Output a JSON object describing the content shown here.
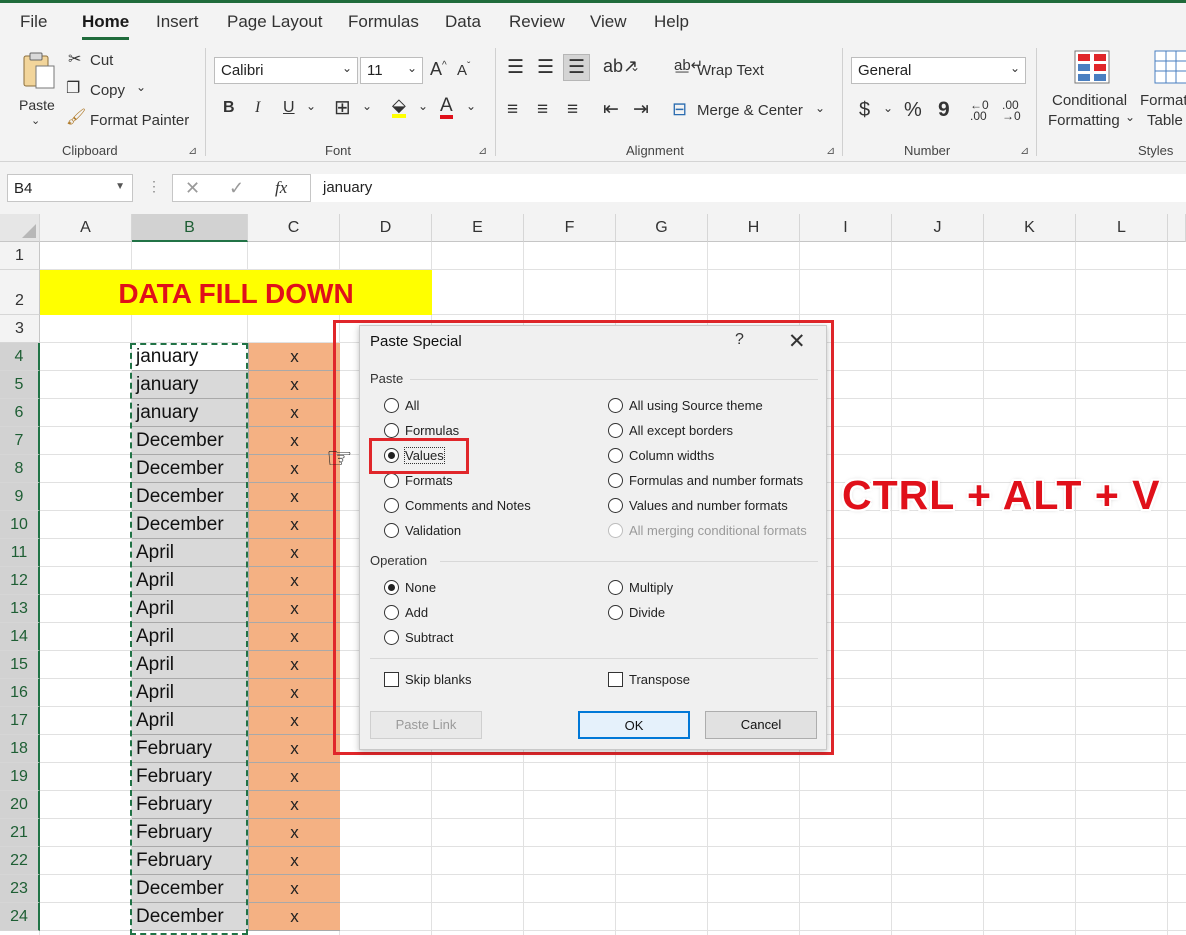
{
  "menu": {
    "items": [
      "File",
      "Home",
      "Insert",
      "Page Layout",
      "Formulas",
      "Data",
      "Review",
      "View",
      "Help"
    ],
    "active": "Home"
  },
  "ribbon": {
    "clipboard": {
      "paste": "Paste",
      "cut": "Cut",
      "copy": "Copy",
      "format_painter": "Format Painter",
      "label": "Clipboard"
    },
    "font": {
      "family": "Calibri",
      "size": "11",
      "bold": "B",
      "italic": "I",
      "underline": "U",
      "label": "Font"
    },
    "alignment": {
      "wrap_text": "Wrap Text",
      "merge_center": "Merge & Center",
      "label": "Alignment"
    },
    "number": {
      "format": "General",
      "currency": "$",
      "percent": "%",
      "comma": "9",
      "label": "Number"
    },
    "styles": {
      "conditional": "Conditional",
      "formatting": "Formatting",
      "format_as": "Format",
      "table": "Table",
      "label": "Styles"
    },
    "colors": {
      "font_color": "#e0101a",
      "highlight": "#ffff00",
      "accent": "#217346"
    }
  },
  "formula_bar": {
    "name_box": "B4",
    "fx": "fx",
    "value": "january"
  },
  "sheet": {
    "columns": [
      "A",
      "B",
      "C",
      "D",
      "E",
      "F",
      "G",
      "H",
      "I",
      "J",
      "K",
      "L"
    ],
    "selected_column": "B",
    "rows": [
      "1",
      "2",
      "3",
      "4",
      "5",
      "6",
      "7",
      "8",
      "9",
      "10",
      "11",
      "12",
      "13",
      "14",
      "15",
      "16",
      "17",
      "18",
      "19",
      "20",
      "21",
      "22",
      "23",
      "24"
    ],
    "banner": "DATA FILL DOWN",
    "column_b": [
      "january",
      "january",
      "january",
      "December",
      "December",
      "December",
      "December",
      "April",
      "April",
      "April",
      "April",
      "April",
      "April",
      "April",
      "February",
      "February",
      "February",
      "February",
      "February",
      "December",
      "December"
    ],
    "column_c": [
      "x",
      "x",
      "x",
      "x",
      "x",
      "x",
      "x",
      "x",
      "x",
      "x",
      "x",
      "x",
      "x",
      "x",
      "x",
      "x",
      "x",
      "x",
      "x",
      "x",
      "x"
    ]
  },
  "dialog": {
    "title": "Paste Special",
    "help": "?",
    "close": "✕",
    "paste_label": "Paste",
    "paste_left": [
      "All",
      "Formulas",
      "Values",
      "Formats",
      "Comments and Notes",
      "Validation"
    ],
    "paste_right": [
      "All using Source theme",
      "All except borders",
      "Column widths",
      "Formulas and number formats",
      "Values and number formats",
      "All merging conditional formats"
    ],
    "paste_selected": "Values",
    "operation_label": "Operation",
    "operation_left": [
      "None",
      "Add",
      "Subtract"
    ],
    "operation_right": [
      "Multiply",
      "Divide"
    ],
    "operation_selected": "None",
    "skip_blanks": "Skip blanks",
    "transpose": "Transpose",
    "paste_link": "Paste Link",
    "ok": "OK",
    "cancel": "Cancel"
  },
  "annotation": {
    "shortcut": "CTRL + ALT + V"
  }
}
